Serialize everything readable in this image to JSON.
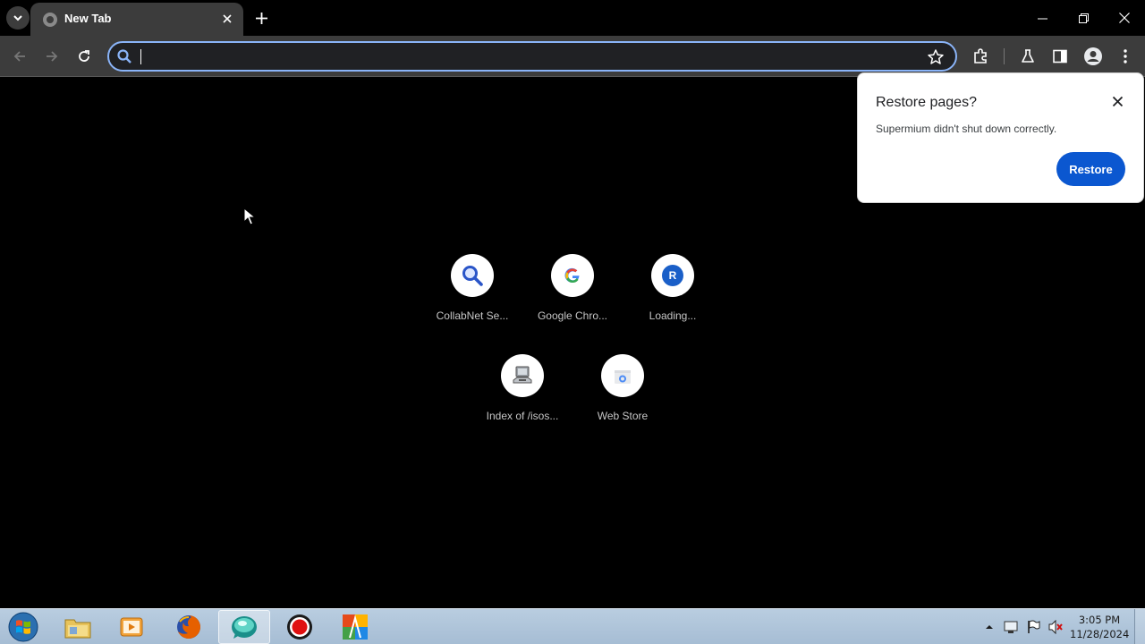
{
  "browser": {
    "tab": {
      "title": "New Tab",
      "favicon": "globe-icon"
    },
    "omnibox": {
      "value": "",
      "placeholder": ""
    },
    "toolbar_icons": [
      "back-icon",
      "forward-icon",
      "reload-icon",
      "star-icon",
      "extensions-icon",
      "labs-icon",
      "side-panel-icon",
      "profile-icon",
      "menu-icon"
    ],
    "accent_color": "#8ab4f8"
  },
  "popup": {
    "title": "Restore pages?",
    "message": "Supermium didn't shut down correctly.",
    "restore_label": "Restore",
    "button_color": "#0b57d0"
  },
  "shortcuts": [
    {
      "label": "CollabNet Se...",
      "icon": "search-icon"
    },
    {
      "label": "Google Chro...",
      "icon": "google-icon"
    },
    {
      "label": "Loading...",
      "icon": "letter-r-icon",
      "letter": "R"
    },
    {
      "label": "Index of /isos...",
      "icon": "computer-icon"
    },
    {
      "label": "Web Store",
      "icon": "web-store-icon"
    }
  ],
  "taskbar": {
    "apps": [
      "explorer-icon",
      "media-player-icon",
      "firefox-icon",
      "supermium-icon",
      "record-icon",
      "app-icon"
    ],
    "clock": {
      "time": "3:05 PM",
      "date": "11/28/2024"
    }
  }
}
